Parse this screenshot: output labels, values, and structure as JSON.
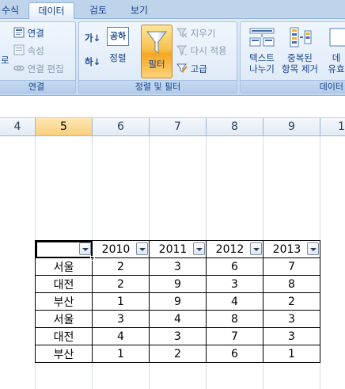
{
  "tabs": [
    "수식",
    "데이터",
    "검토",
    "보기"
  ],
  "connections": {
    "left_cut_label": "로",
    "items": [
      "연결",
      "속성",
      "연결 편집"
    ],
    "caption": "연결"
  },
  "sortfilter": {
    "sort_label": "정렬",
    "sort_asc_glyph": "가↓",
    "sort_desc_glyph": "하↓",
    "sort_box_glyph": "공하",
    "filter_label": "필터",
    "side_items": [
      "지우기",
      "다시 적용",
      "고급"
    ],
    "caption": "정렬 및 필터"
  },
  "datatools": {
    "text_to_columns": [
      "텍스트",
      "나누기"
    ],
    "remove_duplicates": [
      "중복된",
      "항목 제거"
    ],
    "validation_partial": [
      "데",
      "유효"
    ],
    "caption_partial": "데이터"
  },
  "columns": [
    "4",
    "5",
    "6",
    "7",
    "8",
    "9",
    "1"
  ],
  "selected_column": "5",
  "table": {
    "headers": [
      "",
      "2010",
      "2011",
      "2012",
      "2013"
    ],
    "rows": [
      [
        "서울",
        "2",
        "3",
        "6",
        "7"
      ],
      [
        "대전",
        "2",
        "9",
        "3",
        "8"
      ],
      [
        "부산",
        "1",
        "9",
        "4",
        "2"
      ],
      [
        "서울",
        "3",
        "4",
        "8",
        "3"
      ],
      [
        "대전",
        "4",
        "3",
        "7",
        "3"
      ],
      [
        "부산",
        "1",
        "2",
        "6",
        "1"
      ]
    ]
  }
}
